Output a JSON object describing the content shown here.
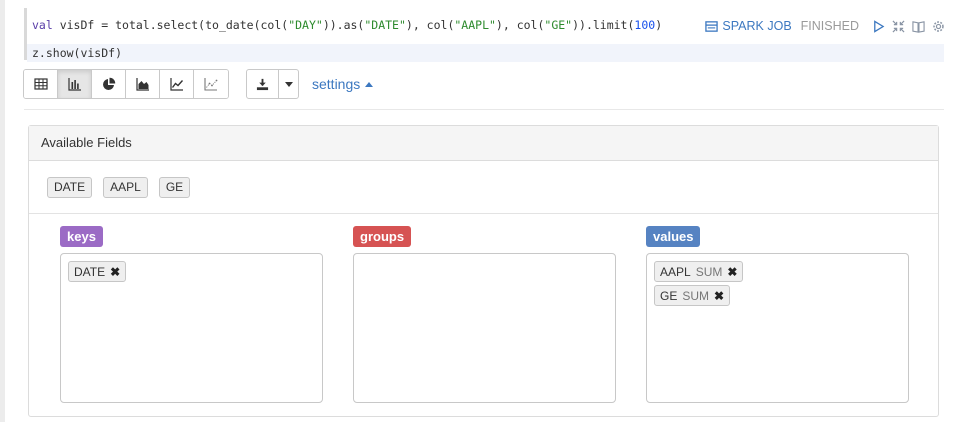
{
  "code": {
    "line1": {
      "kw": "val",
      "p1": " visDf = total.select(to_date(col(",
      "s1": "\"DAY\"",
      "p2": ")).as(",
      "s2": "\"DATE\"",
      "p3": "), col(",
      "s3": "\"AAPL\"",
      "p4": "), col(",
      "s4": "\"GE\"",
      "p5": ")).limit(",
      "n1": "100",
      "p6": ")"
    },
    "line2": "z.show(visDf)"
  },
  "status": {
    "spark_job_label": "SPARK JOB",
    "state": "FINISHED",
    "colors": {
      "link": "#3c78c0",
      "muted": "#9a9a9a"
    }
  },
  "toolbar": {
    "chart_types": [
      {
        "name": "table",
        "icon": "table-icon",
        "active": false
      },
      {
        "name": "bar",
        "icon": "bar-chart-icon",
        "active": true
      },
      {
        "name": "pie",
        "icon": "pie-chart-icon",
        "active": false
      },
      {
        "name": "area",
        "icon": "area-chart-icon",
        "active": false
      },
      {
        "name": "line",
        "icon": "line-chart-icon",
        "active": false
      },
      {
        "name": "scatter",
        "icon": "scatter-chart-icon",
        "active": false
      }
    ],
    "download_icon": "download-icon",
    "settings_label": "settings"
  },
  "panel": {
    "heading": "Available Fields",
    "fields": [
      "DATE",
      "AAPL",
      "GE"
    ],
    "keys": {
      "label": "keys",
      "color": "#9b6bc5",
      "items": [
        {
          "name": "DATE"
        }
      ]
    },
    "groups": {
      "label": "groups",
      "color": "#d65353",
      "items": []
    },
    "values": {
      "label": "values",
      "color": "#5683c2",
      "items": [
        {
          "name": "AAPL",
          "agg": "SUM"
        },
        {
          "name": "GE",
          "agg": "SUM"
        }
      ]
    }
  }
}
